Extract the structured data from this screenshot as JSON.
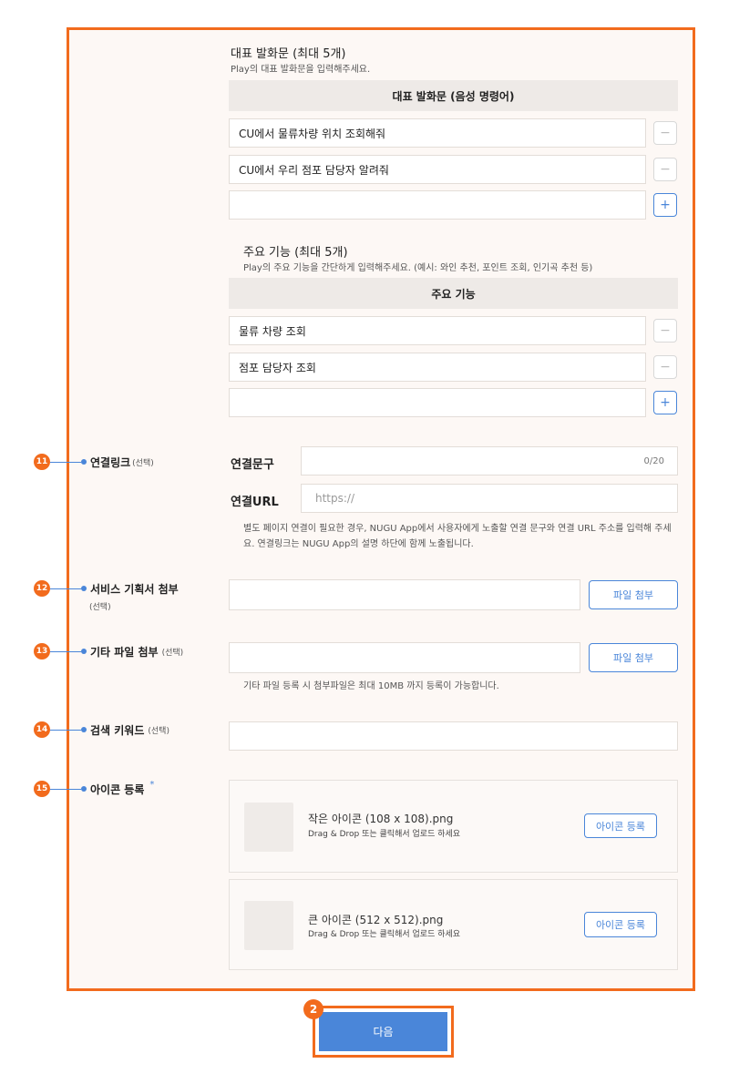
{
  "utterances": {
    "title": "대표 발화문 (최대 5개)",
    "subtitle": "Play의 대표 발화문을 입력해주세요.",
    "table_header": "대표 발화문 (음성 명령어)",
    "items": [
      "CU에서 물류차량 위치 조회해줘",
      "CU에서 우리 점포 담당자 알려줘",
      ""
    ]
  },
  "features": {
    "title": "주요 기능 (최대 5개)",
    "subtitle": "Play의 주요 기능을 간단하게 입력해주세요. (예시: 와인 추천, 포인트 조회, 인기곡 추천 등)",
    "table_header": "주요 기능",
    "items": [
      "물류 차량 조회",
      "점포 담당자 조회",
      ""
    ]
  },
  "buttons": {
    "minus": "−",
    "plus": "+"
  },
  "link": {
    "badge": "11",
    "label": "연결링크",
    "optional": "(선택)",
    "phrase_label": "연결문구",
    "phrase_counter": "0/20",
    "url_label": "연결URL",
    "url_placeholder": "https://",
    "help": "별도 페이지 연결이 필요한 경우, NUGU App에서 사용자에게 노출할 연결 문구와 연결 URL 주소를 입력해 주세요. 연결링크는 NUGU App의 설명 하단에 함께 노출됩니다."
  },
  "service_doc": {
    "badge": "12",
    "label": "서비스 기획서 첨부",
    "optional": "(선택)",
    "button": "파일 첨부"
  },
  "other_file": {
    "badge": "13",
    "label": "기타 파일 첨부",
    "optional": "(선택)",
    "button": "파일 첨부",
    "help": "기타 파일 등록 시 첨부파일은 최대 10MB 까지 등록이 가능합니다."
  },
  "keyword": {
    "badge": "14",
    "label": "검색 키워드",
    "optional": "(선택)"
  },
  "icon": {
    "badge": "15",
    "label": "아이콘 등록",
    "required_mark": "*",
    "small_name": "작은 아이콘 (108 x 108).png",
    "large_name": "큰 아이콘 (512 x 512).png",
    "hint": "Drag & Drop 또는 클릭해서 업로드 하세요",
    "button": "아이콘 등록"
  },
  "footer": {
    "badge": "2",
    "next": "다음"
  },
  "colors": {
    "accent_orange": "#f26b1d",
    "primary_blue": "#4a86d9",
    "panel_bg": "#fdf8f5"
  }
}
